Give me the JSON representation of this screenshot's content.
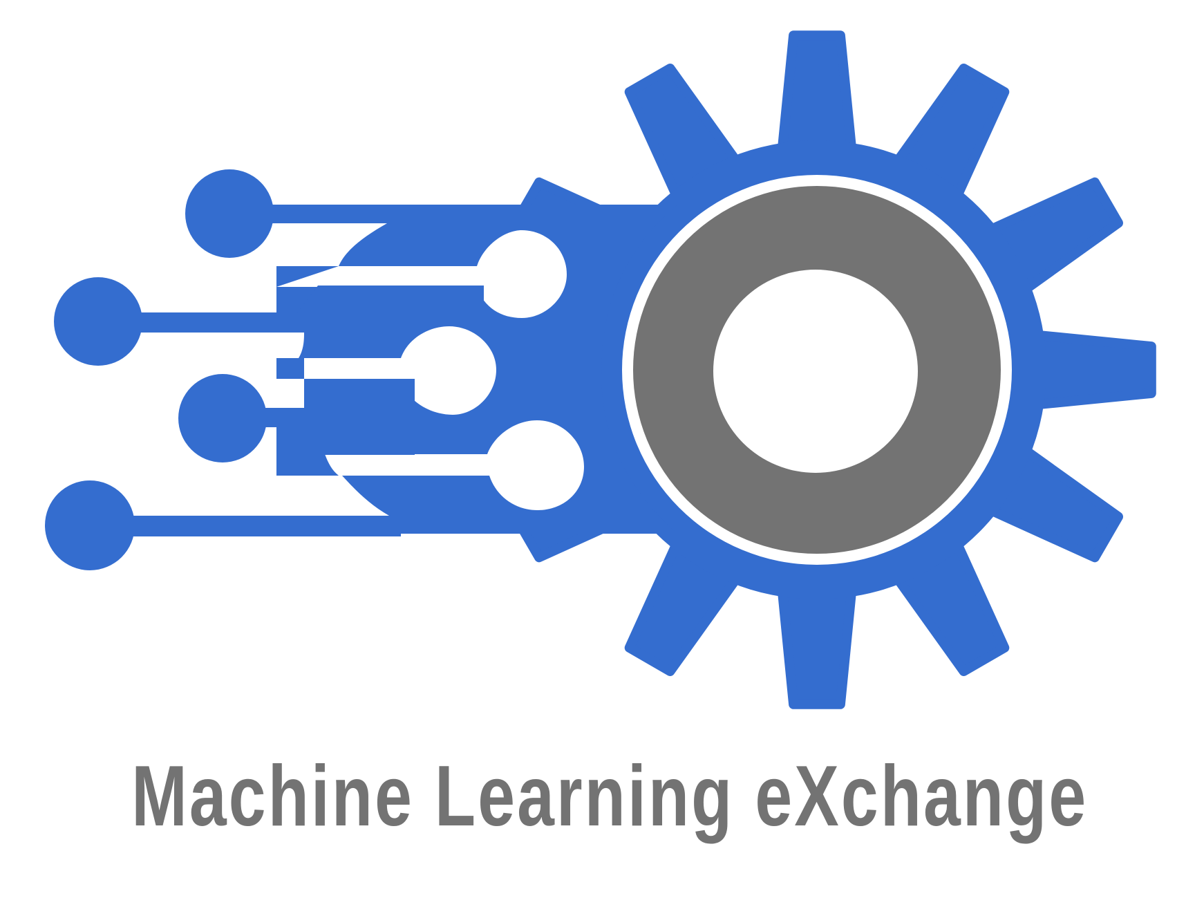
{
  "logo": {
    "wordmark": "Machine Learning eXchange",
    "colors": {
      "blue": "#346dcf",
      "gray": "#737373",
      "background": "#ffffff"
    },
    "icons": {
      "gear": "gear-icon",
      "circuit": "circuit-traces-icon"
    }
  }
}
